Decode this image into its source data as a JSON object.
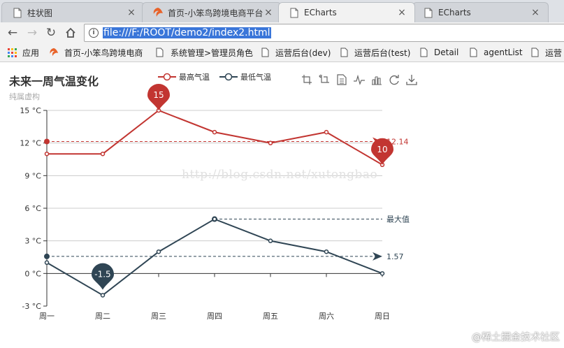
{
  "browser": {
    "tabs": [
      {
        "label": "柱状图",
        "icon": "page-icon",
        "active": false
      },
      {
        "label": "首页-小笨鸟跨境电商平台",
        "icon": "site-logo-icon",
        "active": false
      },
      {
        "label": "ECharts",
        "icon": "page-icon",
        "active": true
      },
      {
        "label": "ECharts",
        "icon": "page-icon",
        "active": false
      }
    ],
    "tab_close": "×",
    "address": "file:///F:/ROOT/demo2/index2.html",
    "bookmarks": [
      {
        "label": "应用",
        "icon": "apps-grid-icon"
      },
      {
        "label": "首页-小笨鸟跨境电商",
        "icon": "site-logo-icon"
      },
      {
        "label": "系统管理>管理员角色",
        "icon": "page-icon"
      },
      {
        "label": "运营后台(dev)",
        "icon": "page-icon"
      },
      {
        "label": "运营后台(test)",
        "icon": "page-icon"
      },
      {
        "label": "Detail",
        "icon": "page-icon"
      },
      {
        "label": "agentList",
        "icon": "page-icon"
      },
      {
        "label": "运营",
        "icon": "page-icon"
      }
    ]
  },
  "page": {
    "watermark": "http://blog.csdn.net/xutongbao",
    "site_watermark": "@稀土掘金技术社区"
  },
  "chart_data": {
    "type": "line",
    "title": "未来一周气温变化",
    "subtitle": "纯属虚构",
    "categories": [
      "周一",
      "周二",
      "周三",
      "周四",
      "周五",
      "周六",
      "周日"
    ],
    "y_ticks": [
      "-3 °C",
      "0 °C",
      "3 °C",
      "6 °C",
      "9 °C",
      "12 °C",
      "15 °C"
    ],
    "ylim": [
      -3,
      15
    ],
    "y_unit": " °C",
    "series": [
      {
        "name": "最高气温",
        "values": [
          11,
          11,
          15,
          13,
          12,
          13,
          10
        ],
        "color": "#c23531",
        "mark_points": [
          {
            "index": 2,
            "label": "15"
          },
          {
            "index": 6,
            "label": "10"
          }
        ],
        "mark_line": {
          "value": 12.14,
          "label": "12.14"
        }
      },
      {
        "name": "最低气温",
        "values": [
          1,
          -2,
          2,
          5,
          3,
          2,
          0
        ],
        "color": "#2f4554",
        "mark_points": [
          {
            "index": 1,
            "label": "-1.5",
            "value": -1.5
          }
        ],
        "mark_line": {
          "value": 1.57,
          "label": "1.57"
        },
        "max_line": {
          "index": 3,
          "value": 5,
          "label": "最大值"
        }
      }
    ],
    "legend": "top-center",
    "grid": true
  },
  "toolbox": [
    "zoom-icon",
    "zoom-reset-icon",
    "data-view-icon",
    "line-chart-icon",
    "bar-chart-icon",
    "restore-icon",
    "save-image-icon"
  ]
}
